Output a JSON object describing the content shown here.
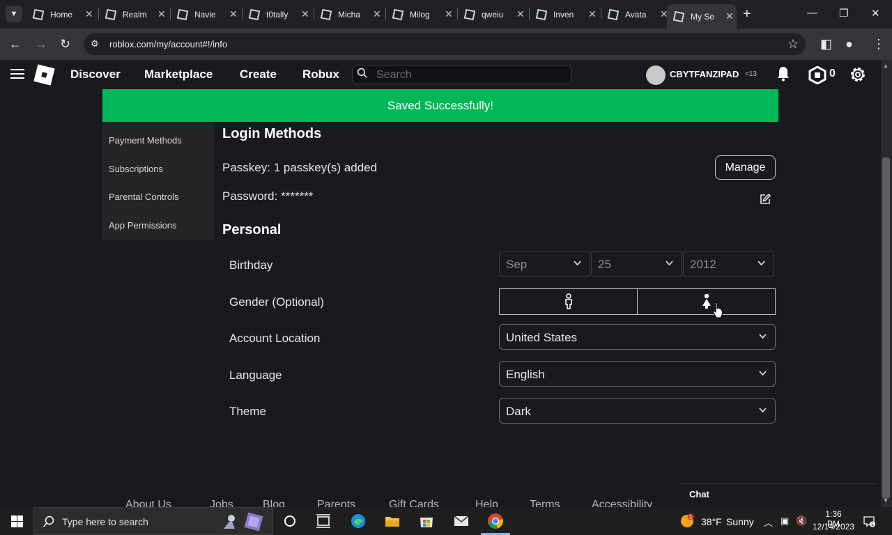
{
  "browser": {
    "tabs": [
      {
        "title": "Home",
        "active": false
      },
      {
        "title": "Realm",
        "active": false
      },
      {
        "title": "Navie",
        "active": false
      },
      {
        "title": "t0tally",
        "active": false
      },
      {
        "title": "Micha",
        "active": false
      },
      {
        "title": "Milog",
        "active": false
      },
      {
        "title": "qweiu",
        "active": false
      },
      {
        "title": "Inven",
        "active": false
      },
      {
        "title": "Avata",
        "active": false
      },
      {
        "title": "My Se",
        "active": true
      }
    ],
    "url": "roblox.com/my/account#!/info"
  },
  "header": {
    "nav": [
      "Discover",
      "Marketplace",
      "Create",
      "Robux"
    ],
    "search_placeholder": "Search",
    "username": "CBYTFANZIPAD",
    "age_label": "<13",
    "robux_count": "0"
  },
  "banner": {
    "message": "Saved Successfully!",
    "color": "#02b757"
  },
  "side_menu": {
    "items": [
      "Payment Methods",
      "Subscriptions",
      "Parental Controls",
      "App Permissions"
    ]
  },
  "login_methods": {
    "title": "Login Methods",
    "passkey_label": "Passkey:",
    "passkey_value": "1 passkey(s) added",
    "manage_label": "Manage",
    "password_label": "Password:",
    "password_value": "*******"
  },
  "personal": {
    "title": "Personal",
    "birthday_label": "Birthday",
    "birth_month": "Sep",
    "birth_day": "25",
    "birth_year": "2012",
    "gender_label": "Gender (Optional)",
    "location_label": "Account Location",
    "location_value": "United States",
    "language_label": "Language",
    "language_value": "English",
    "theme_label": "Theme",
    "theme_value": "Dark"
  },
  "footer": {
    "links": [
      "About Us",
      "Jobs",
      "Blog",
      "Parents",
      "Gift Cards",
      "Help",
      "Terms",
      "Accessibility"
    ],
    "chat_label": "Chat"
  },
  "taskbar": {
    "search_placeholder": "Type here to search",
    "temperature": "38°F",
    "weather": "Sunny",
    "weather_badge": "1",
    "time": "1:36 PM",
    "date": "12/14/2023",
    "notification_count": "5"
  }
}
